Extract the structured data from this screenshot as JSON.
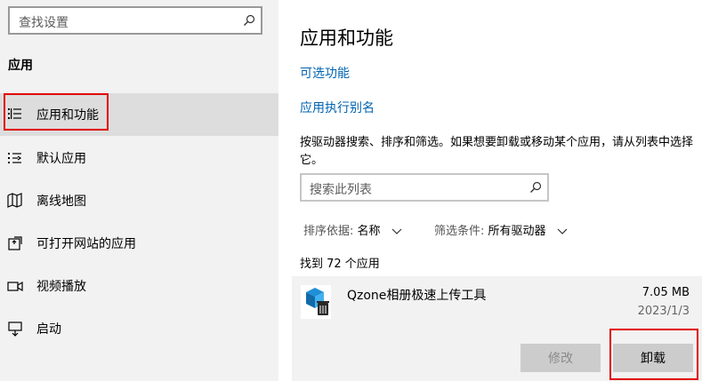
{
  "sidebar": {
    "search_placeholder": "查找设置",
    "section_title": "应用",
    "items": [
      {
        "label": "应用和功能",
        "icon": "apps-features-icon",
        "selected": true
      },
      {
        "label": "默认应用",
        "icon": "default-apps-icon",
        "selected": false
      },
      {
        "label": "离线地图",
        "icon": "offline-maps-icon",
        "selected": false
      },
      {
        "label": "可打开网站的应用",
        "icon": "apps-for-websites-icon",
        "selected": false
      },
      {
        "label": "视频播放",
        "icon": "video-playback-icon",
        "selected": false
      },
      {
        "label": "启动",
        "icon": "startup-icon",
        "selected": false
      }
    ]
  },
  "main": {
    "title": "应用和功能",
    "optional_features_link": "可选功能",
    "app_alias_link": "应用执行别名",
    "description": "按驱动器搜索、排序和筛选。如果想要卸载或移动某个应用，请从列表中选择它。",
    "list_search_placeholder": "搜索此列表",
    "sort_label": "排序依据:",
    "sort_value": "名称",
    "filter_label": "筛选条件:",
    "filter_value": "所有驱动器",
    "found_text": "找到 72 个应用",
    "app": {
      "name": "Qzone相册极速上传工具",
      "size": "7.05 MB",
      "date": "2023/1/3",
      "modify_label": "修改",
      "uninstall_label": "卸载"
    }
  },
  "colors": {
    "accent_link": "#0063b1",
    "highlight_outline": "#e00000"
  }
}
